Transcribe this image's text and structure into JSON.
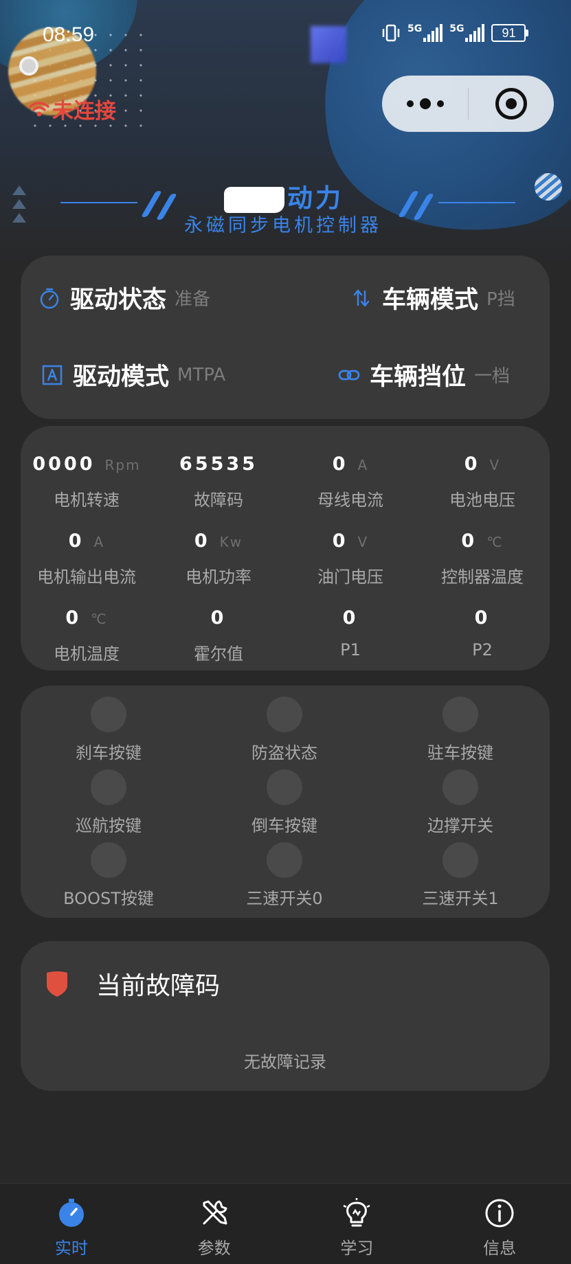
{
  "status_bar": {
    "time": "08:59",
    "net1": "5G",
    "net2": "5G",
    "battery": "91"
  },
  "connection": {
    "label": "未连接",
    "color": "#e5473d"
  },
  "brand": {
    "title": "动力",
    "subtitle": "永磁同步电机控制器"
  },
  "status": {
    "drive_state": {
      "label": "驱动状态",
      "value": "准备",
      "icon": "timer-icon"
    },
    "vehicle_mode": {
      "label": "车辆模式",
      "value": "P挡",
      "icon": "swap-arrows-icon"
    },
    "drive_mode": {
      "label": "驱动模式",
      "value": "MTPA",
      "icon": "letter-a-icon"
    },
    "vehicle_gear": {
      "label": "车辆挡位",
      "value": "一档",
      "icon": "link-icon"
    }
  },
  "metrics": [
    {
      "value": "0000",
      "unit": "Rpm",
      "label": "电机转速"
    },
    {
      "value": "65535",
      "unit": "",
      "label": "故障码"
    },
    {
      "value": "0",
      "unit": "A",
      "label": "母线电流"
    },
    {
      "value": "0",
      "unit": "V",
      "label": "电池电压"
    },
    {
      "value": "0",
      "unit": "A",
      "label": "电机输出电流"
    },
    {
      "value": "0",
      "unit": "Kw",
      "label": "电机功率"
    },
    {
      "value": "0",
      "unit": "V",
      "label": "油门电压"
    },
    {
      "value": "0",
      "unit": "℃",
      "label": "控制器温度"
    },
    {
      "value": "0",
      "unit": "℃",
      "label": "电机温度"
    },
    {
      "value": "0",
      "unit": "",
      "label": "霍尔值"
    },
    {
      "value": "0",
      "unit": "",
      "label": "P1"
    },
    {
      "value": "0",
      "unit": "",
      "label": "P2"
    }
  ],
  "switches": [
    {
      "label": "刹车按键"
    },
    {
      "label": "防盗状态"
    },
    {
      "label": "驻车按键"
    },
    {
      "label": "巡航按键"
    },
    {
      "label": "倒车按键"
    },
    {
      "label": "边撑开关"
    },
    {
      "label": "BOOST按键"
    },
    {
      "label": "三速开关0"
    },
    {
      "label": "三速开关1"
    }
  ],
  "fault": {
    "title": "当前故障码",
    "empty": "无故障记录"
  },
  "tabs": [
    {
      "label": "实时",
      "icon": "stopwatch-icon",
      "active": true
    },
    {
      "label": "参数",
      "icon": "tools-icon",
      "active": false
    },
    {
      "label": "学习",
      "icon": "lightbulb-icon",
      "active": false
    },
    {
      "label": "信息",
      "icon": "info-icon",
      "active": false
    }
  ],
  "colors": {
    "accent": "#3a84e8",
    "card": "#393939",
    "background": "#282828",
    "danger": "#e5473d"
  }
}
